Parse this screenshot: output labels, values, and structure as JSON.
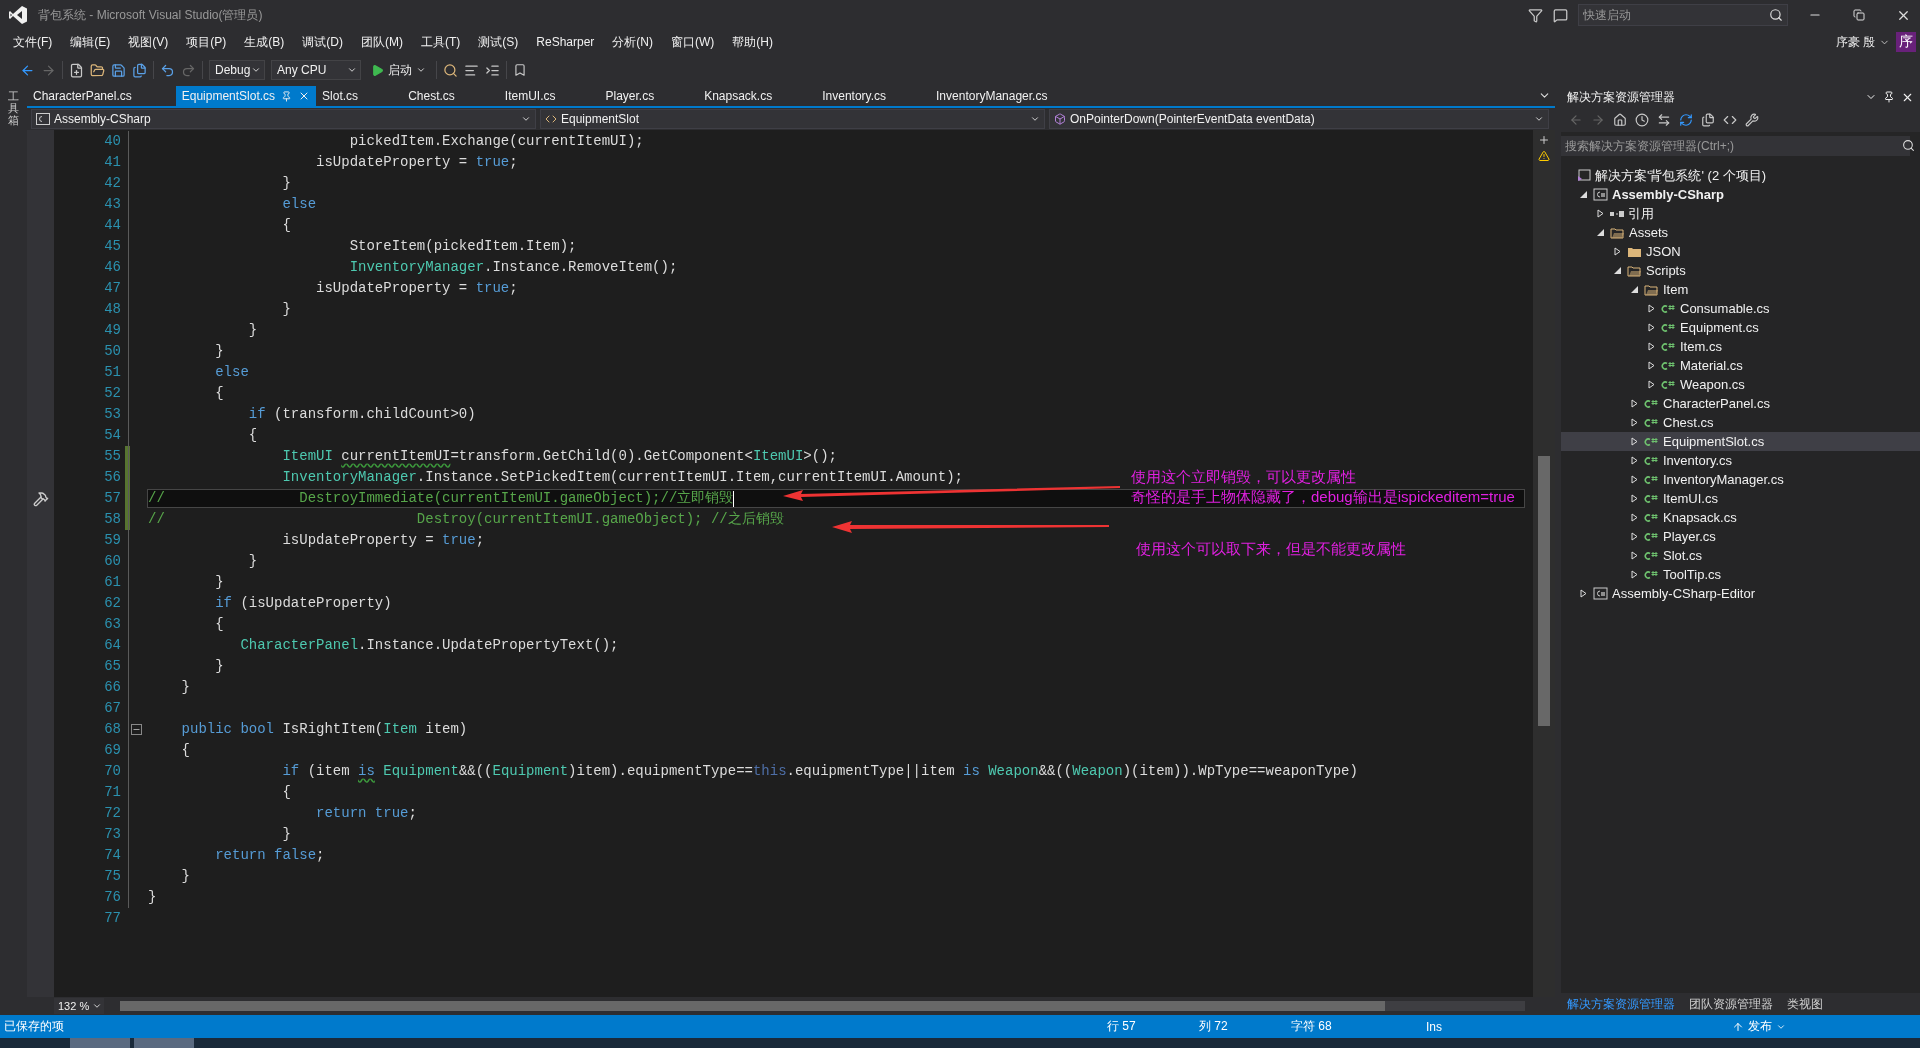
{
  "window": {
    "title": "背包系统 - Microsoft Visual Studio(管理员)",
    "quick_launch": {
      "placeholder": "快速启动"
    },
    "user": "序豪 殷",
    "avatar": "序"
  },
  "menu": [
    "文件(F)",
    "编辑(E)",
    "视图(V)",
    "项目(P)",
    "生成(B)",
    "调试(D)",
    "团队(M)",
    "工具(T)",
    "测试(S)",
    "ReSharper",
    "分析(N)",
    "窗口(W)",
    "帮助(H)"
  ],
  "toolbar": {
    "configuration": "Debug",
    "platform": "Any CPU",
    "start": "启动"
  },
  "toolbox_label": "工具箱",
  "tabs": [
    {
      "label": "CharacterPanel.cs",
      "selected": false
    },
    {
      "label": "EquipmentSlot.cs",
      "selected": true
    },
    {
      "label": "Slot.cs",
      "selected": false
    },
    {
      "label": "Chest.cs",
      "selected": false
    },
    {
      "label": "ItemUI.cs",
      "selected": false
    },
    {
      "label": "Player.cs",
      "selected": false
    },
    {
      "label": "Knapsack.cs",
      "selected": false
    },
    {
      "label": "Inventory.cs",
      "selected": false
    },
    {
      "label": "InventoryManager.cs",
      "selected": false
    }
  ],
  "navigation": {
    "project": "Assembly-CSharp",
    "type": "EquipmentSlot",
    "member": "OnPointerDown(PointerEventData eventData)"
  },
  "code_lines": [
    {
      "number": "40",
      "tokens": [
        {
          "kind": "plain",
          "text": "                        pickedItem.Exchange(currentItemUI);"
        }
      ]
    },
    {
      "number": "41",
      "tokens": [
        {
          "kind": "plain",
          "text": "                    isUpdateProperty = "
        },
        {
          "kind": "keyword",
          "text": "true"
        },
        {
          "kind": "plain",
          "text": ";"
        }
      ]
    },
    {
      "number": "42",
      "tokens": [
        {
          "kind": "plain",
          "text": "                }"
        }
      ]
    },
    {
      "number": "43",
      "tokens": [
        {
          "kind": "keyword",
          "text": "                else"
        }
      ]
    },
    {
      "number": "44",
      "tokens": [
        {
          "kind": "plain",
          "text": "                {"
        }
      ]
    },
    {
      "number": "45",
      "tokens": [
        {
          "kind": "plain",
          "text": "                        StoreItem(pickedItem.Item);"
        }
      ]
    },
    {
      "number": "46",
      "tokens": [
        {
          "kind": "type",
          "text": "                        InventoryManager"
        },
        {
          "kind": "plain",
          "text": ".Instance.RemoveItem();"
        }
      ]
    },
    {
      "number": "47",
      "tokens": [
        {
          "kind": "plain",
          "text": "                    isUpdateProperty = "
        },
        {
          "kind": "keyword",
          "text": "true"
        },
        {
          "kind": "plain",
          "text": ";"
        }
      ]
    },
    {
      "number": "48",
      "tokens": [
        {
          "kind": "plain",
          "text": "                }"
        }
      ]
    },
    {
      "number": "49",
      "tokens": [
        {
          "kind": "plain",
          "text": "            }"
        }
      ]
    },
    {
      "number": "50",
      "tokens": [
        {
          "kind": "plain",
          "text": "        }"
        }
      ]
    },
    {
      "number": "51",
      "tokens": [
        {
          "kind": "keyword",
          "text": "        else"
        }
      ]
    },
    {
      "number": "52",
      "tokens": [
        {
          "kind": "plain",
          "text": "        {"
        }
      ]
    },
    {
      "number": "53",
      "tokens": [
        {
          "kind": "keyword",
          "text": "            if"
        },
        {
          "kind": "plain",
          "text": " (transform.childCount>0)"
        }
      ]
    },
    {
      "number": "54",
      "tokens": [
        {
          "kind": "plain",
          "text": "            {"
        }
      ]
    },
    {
      "number": "55",
      "changed": true,
      "tokens": [
        {
          "kind": "type",
          "text": "                ItemUI "
        },
        {
          "kind": "plain",
          "text": "currentItemUI",
          "squiggle": true
        },
        {
          "kind": "plain",
          "text": "=transform.GetChild(0).GetComponent<"
        },
        {
          "kind": "type",
          "text": "ItemUI"
        },
        {
          "kind": "plain",
          "text": ">();"
        }
      ]
    },
    {
      "number": "56",
      "changed": true,
      "tokens": [
        {
          "kind": "type",
          "text": "                InventoryManager"
        },
        {
          "kind": "plain",
          "text": ".Instance.SetPickedItem(currentItemUI.Item,currentItemUI.Amount);"
        }
      ]
    },
    {
      "number": "57",
      "changed": true,
      "current": true,
      "quick_action": true,
      "tokens": [
        {
          "kind": "comment",
          "text": "//                DestroyImmediate(currentItemUI.gameObject);//立即销毁"
        }
      ]
    },
    {
      "number": "58",
      "changed": true,
      "tokens": [
        {
          "kind": "comment",
          "text": "//                              Destroy(currentItemUI.gameObject); //之后销毁"
        }
      ]
    },
    {
      "number": "59",
      "tokens": [
        {
          "kind": "plain",
          "text": "                isUpdateProperty = "
        },
        {
          "kind": "keyword",
          "text": "true"
        },
        {
          "kind": "plain",
          "text": ";"
        }
      ]
    },
    {
      "number": "60",
      "tokens": [
        {
          "kind": "plain",
          "text": "            }"
        }
      ]
    },
    {
      "number": "61",
      "tokens": [
        {
          "kind": "plain",
          "text": "        }"
        }
      ]
    },
    {
      "number": "62",
      "tokens": [
        {
          "kind": "keyword",
          "text": "        if"
        },
        {
          "kind": "plain",
          "text": " (isUpdateProperty)"
        }
      ]
    },
    {
      "number": "63",
      "tokens": [
        {
          "kind": "plain",
          "text": "        {"
        }
      ]
    },
    {
      "number": "64",
      "tokens": [
        {
          "kind": "type",
          "text": "           CharacterPanel"
        },
        {
          "kind": "plain",
          "text": ".Instance.UpdatePropertyText();"
        }
      ]
    },
    {
      "number": "65",
      "tokens": [
        {
          "kind": "plain",
          "text": "        }"
        }
      ]
    },
    {
      "number": "66",
      "tokens": [
        {
          "kind": "plain",
          "text": "    }"
        }
      ]
    },
    {
      "number": "67"
    },
    {
      "number": "68",
      "fold": true,
      "tokens": [
        {
          "kind": "keyword",
          "text": "    public bool"
        },
        {
          "kind": "plain",
          "text": " IsRightItem("
        },
        {
          "kind": "type",
          "text": "Item"
        },
        {
          "kind": "plain",
          "text": " item)"
        }
      ]
    },
    {
      "number": "69",
      "tokens": [
        {
          "kind": "plain",
          "text": "    {"
        }
      ]
    },
    {
      "number": "70",
      "tokens": [
        {
          "kind": "keyword",
          "text": "                if"
        },
        {
          "kind": "plain",
          "text": " (item "
        },
        {
          "kind": "keyword",
          "text": "is",
          "squiggle": true
        },
        {
          "kind": "type",
          "text": " Equipment"
        },
        {
          "kind": "plain",
          "text": "&&(("
        },
        {
          "kind": "type",
          "text": "Equipment"
        },
        {
          "kind": "plain",
          "text": ")item).equipmentType=="
        },
        {
          "kind": "this",
          "text": "this"
        },
        {
          "kind": "plain",
          "text": ".equipmentType||item "
        },
        {
          "kind": "keyword",
          "text": "is"
        },
        {
          "kind": "type",
          "text": " Weapon"
        },
        {
          "kind": "plain",
          "text": "&&(("
        },
        {
          "kind": "type",
          "text": "Weapon"
        },
        {
          "kind": "plain",
          "text": ")(item)).WpType==weaponType)"
        }
      ]
    },
    {
      "number": "71",
      "tokens": [
        {
          "kind": "plain",
          "text": "                {"
        }
      ]
    },
    {
      "number": "72",
      "tokens": [
        {
          "kind": "keyword",
          "text": "                    return true"
        },
        {
          "kind": "plain",
          "text": ";"
        }
      ]
    },
    {
      "number": "73",
      "tokens": [
        {
          "kind": "plain",
          "text": "                }"
        }
      ]
    },
    {
      "number": "74",
      "tokens": [
        {
          "kind": "keyword",
          "text": "        return false"
        },
        {
          "kind": "plain",
          "text": ";"
        }
      ]
    },
    {
      "number": "75",
      "tokens": [
        {
          "kind": "plain",
          "text": "    }"
        }
      ]
    },
    {
      "number": "76",
      "tokens": [
        {
          "kind": "plain",
          "text": "}"
        }
      ]
    },
    {
      "number": "77"
    }
  ],
  "annotations": [
    "使用这个立即销毁，可以更改属性",
    "奇怪的是手上物体隐藏了，debug输出是ispickeditem=true",
    "使用这个可以取下来，但是不能更改属性"
  ],
  "zoom": "132 %",
  "solution_explorer": {
    "title": "解决方案资源管理器",
    "search": {
      "placeholder": "搜索解决方案资源管理器(Ctrl+;)"
    },
    "tree": [
      {
        "label": "解决方案'背包系统' (2 个项目)",
        "kind": "solution",
        "selected": false,
        "children": [
          {
            "label": "Assembly-CSharp",
            "kind": "project",
            "expanded": true,
            "selected": false,
            "children": [
              {
                "label": "引用",
                "kind": "references",
                "expanded": false,
                "selected": false
              },
              {
                "label": "Assets",
                "kind": "folder",
                "expanded": true,
                "selected": false,
                "children": [
                  {
                    "label": "JSON",
                    "kind": "folder",
                    "expanded": false,
                    "selected": false
                  },
                  {
                    "label": "Scripts",
                    "kind": "folder",
                    "expanded": true,
                    "selected": false,
                    "children": [
                      {
                        "label": "Item",
                        "kind": "folder",
                        "expanded": true,
                        "selected": false,
                        "children": [
                          {
                            "label": "Consumable.cs",
                            "kind": "file",
                            "expanded": false,
                            "selected": false
                          },
                          {
                            "label": "Equipment.cs",
                            "kind": "file",
                            "expanded": false,
                            "selected": false
                          },
                          {
                            "label": "Item.cs",
                            "kind": "file",
                            "expanded": false,
                            "selected": false
                          },
                          {
                            "label": "Material.cs",
                            "kind": "file",
                            "expanded": false,
                            "selected": false
                          },
                          {
                            "label": "Weapon.cs",
                            "kind": "file",
                            "expanded": false,
                            "selected": false
                          }
                        ]
                      },
                      {
                        "label": "CharacterPanel.cs",
                        "kind": "file",
                        "expanded": false,
                        "selected": false
                      },
                      {
                        "label": "Chest.cs",
                        "kind": "file",
                        "expanded": false,
                        "selected": false
                      },
                      {
                        "label": "EquipmentSlot.cs",
                        "kind": "file",
                        "expanded": false,
                        "selected": true
                      },
                      {
                        "label": "Inventory.cs",
                        "kind": "file",
                        "expanded": false,
                        "selected": false
                      },
                      {
                        "label": "InventoryManager.cs",
                        "kind": "file",
                        "expanded": false,
                        "selected": false
                      },
                      {
                        "label": "ItemUI.cs",
                        "kind": "file",
                        "expanded": false,
                        "selected": false
                      },
                      {
                        "label": "Knapsack.cs",
                        "kind": "file",
                        "expanded": false,
                        "selected": false
                      },
                      {
                        "label": "Player.cs",
                        "kind": "file",
                        "expanded": false,
                        "selected": false
                      },
                      {
                        "label": "Slot.cs",
                        "kind": "file",
                        "expanded": false,
                        "selected": false
                      },
                      {
                        "label": "ToolTip.cs",
                        "kind": "file",
                        "expanded": false,
                        "selected": false
                      }
                    ]
                  }
                ]
              }
            ]
          },
          {
            "label": "Assembly-CSharp-Editor",
            "kind": "project",
            "expanded": false,
            "selected": false
          }
        ]
      }
    ],
    "bottom_tabs": [
      {
        "label": "解决方案资源管理器",
        "selected": true
      },
      {
        "label": "团队资源管理器",
        "selected": false
      },
      {
        "label": "类视图",
        "selected": false
      }
    ]
  },
  "status_bar": {
    "message": "已保存的项",
    "line": "行 57",
    "column": "列 72",
    "character": "字符 68",
    "mode": "Ins",
    "publish": "发布"
  }
}
